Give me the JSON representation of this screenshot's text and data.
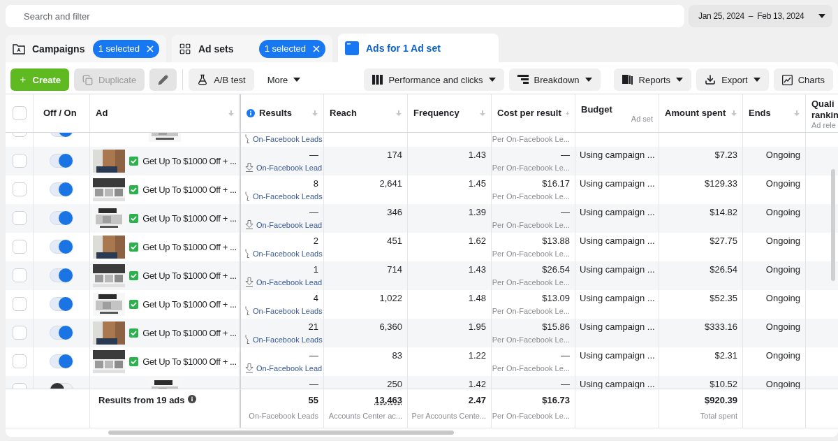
{
  "search": {
    "placeholder": "Search and filter"
  },
  "date_range": {
    "value": "Jan 25, 2024  –  Feb 13, 2024"
  },
  "tabs": [
    {
      "kind": "campaigns",
      "label": "Campaigns",
      "badge": "1 selected",
      "selected": false
    },
    {
      "kind": "adsets",
      "label": "Ad sets",
      "badge": "1 selected",
      "selected": false
    },
    {
      "kind": "ads",
      "label": "Ads for 1 Ad set",
      "selected": true
    }
  ],
  "toolbar": {
    "left": [
      {
        "kind": "create",
        "label": "Create",
        "disabled": false
      },
      {
        "kind": "duplicate",
        "label": "Duplicate",
        "disabled": true
      },
      {
        "kind": "edit",
        "disabled": true
      },
      {
        "kind": "abtest",
        "label": "A/B test",
        "disabled": false
      },
      {
        "kind": "more",
        "label": "More",
        "disabled": false
      }
    ],
    "right": [
      {
        "kind": "columns",
        "label": "Performance and clicks"
      },
      {
        "kind": "breakdown",
        "label": "Breakdown"
      },
      {
        "kind": "reports",
        "label": "Reports"
      },
      {
        "kind": "export",
        "label": "Export"
      },
      {
        "kind": "charts",
        "label": "Charts"
      }
    ]
  },
  "table": {
    "select_all": {
      "checked": false
    },
    "columns": [
      {
        "kind": "check"
      },
      {
        "label": "Off / On",
        "sortable": false
      },
      {
        "label": "Ad",
        "sortable": true
      },
      {
        "label": "Results",
        "sortable": true,
        "info": true
      },
      {
        "label": "Reach",
        "sortable": true
      },
      {
        "label": "Frequency",
        "sortable": true
      },
      {
        "label": "Cost per result",
        "sortable": true
      },
      {
        "label": "Budget",
        "sub": "Ad set",
        "sortable": false
      },
      {
        "label": "Amount spent",
        "sortable": true
      },
      {
        "label": "Ends",
        "sortable": true
      },
      {
        "label": "Quali rankin",
        "sub": "Ad rele"
      }
    ],
    "rows": [
      {
        "checked": false,
        "on": true,
        "results": {
          "kind": "hook",
          "unit": "On-Facebook Leads"
        },
        "cost": {
          "unit": "Per On-Facebook Le..."
        }
      },
      {
        "checked": false,
        "on": true,
        "ad": "Get Up To $1000 Off + ...",
        "results": {
          "kind": "arrow",
          "value": "—",
          "unit": "On-Facebook Lead"
        },
        "reach": "174",
        "frequency": "1.43",
        "cost": {
          "value": "—",
          "unit": "Per On-Facebook Le..."
        },
        "budget": "Using campaign ...",
        "amount": "$7.23",
        "ends": "Ongoing"
      },
      {
        "checked": false,
        "on": true,
        "ad": "Get Up To $1000 Off + ...",
        "results": {
          "kind": "hook",
          "value": "8",
          "unit": "On-Facebook Leads"
        },
        "reach": "2,641",
        "frequency": "1.45",
        "cost": {
          "value": "$16.17",
          "unit": "Per On-Facebook Le..."
        },
        "budget": "Using campaign ...",
        "amount": "$129.33",
        "ends": "Ongoing"
      },
      {
        "checked": false,
        "on": true,
        "ad": "Get Up To $1000 Off + ...",
        "results": {
          "kind": "arrow",
          "value": "—",
          "unit": "On-Facebook Lead"
        },
        "reach": "346",
        "frequency": "1.39",
        "cost": {
          "value": "—",
          "unit": "Per On-Facebook Le..."
        },
        "budget": "Using campaign ...",
        "amount": "$14.82",
        "ends": "Ongoing"
      },
      {
        "checked": false,
        "on": true,
        "ad": "Get Up To $1000 Off + ...",
        "results": {
          "kind": "hook",
          "value": "2",
          "unit": "On-Facebook Leads"
        },
        "reach": "451",
        "frequency": "1.62",
        "cost": {
          "value": "$13.88",
          "unit": "Per On-Facebook Le..."
        },
        "budget": "Using campaign ...",
        "amount": "$27.75",
        "ends": "Ongoing"
      },
      {
        "checked": false,
        "on": true,
        "ad": "Get Up To $1000 Off + ...",
        "results": {
          "kind": "arrow",
          "value": "1",
          "unit": "On-Facebook Lead"
        },
        "reach": "714",
        "frequency": "1.43",
        "cost": {
          "value": "$26.54",
          "unit": "Per On-Facebook Le..."
        },
        "budget": "Using campaign ...",
        "amount": "$26.54",
        "ends": "Ongoing"
      },
      {
        "checked": false,
        "on": true,
        "ad": "Get Up To $1000 Off + ...",
        "results": {
          "kind": "hook",
          "value": "4",
          "unit": "On-Facebook Leads"
        },
        "reach": "1,022",
        "frequency": "1.48",
        "cost": {
          "value": "$13.09",
          "unit": "Per On-Facebook Le..."
        },
        "budget": "Using campaign ...",
        "amount": "$52.35",
        "ends": "Ongoing"
      },
      {
        "checked": false,
        "on": true,
        "ad": "Get Up To $1000 Off + ...",
        "results": {
          "kind": "hook",
          "value": "21",
          "unit": "On-Facebook Leads"
        },
        "reach": "6,360",
        "frequency": "1.95",
        "cost": {
          "value": "$15.86",
          "unit": "Per On-Facebook Le..."
        },
        "budget": "Using campaign ...",
        "amount": "$333.16",
        "ends": "Ongoing"
      },
      {
        "checked": false,
        "on": true,
        "ad": "Get Up To $1000 Off + ...",
        "results": {
          "kind": "arrow",
          "value": "—",
          "unit": "On-Facebook Lead"
        },
        "reach": "83",
        "frequency": "1.22",
        "cost": {
          "value": "—",
          "unit": "Per On-Facebook Le..."
        },
        "budget": "Using campaign ...",
        "amount": "$2.31",
        "ends": "Ongoing"
      },
      {
        "checked": false,
        "on": false,
        "results": {
          "value": "—"
        },
        "reach": "250",
        "frequency": "1.42",
        "cost": {
          "value": "—"
        },
        "budget": "Using campaign ...",
        "amount": "$10.52",
        "ends": "Ongoing"
      }
    ],
    "footer": {
      "label": "Results from 19 ads",
      "results": {
        "value": "55",
        "unit": "On-Facebook Leads"
      },
      "reach": {
        "value": "13,463",
        "unit": "Accounts Center ac..."
      },
      "frequency": {
        "value": "2.47",
        "unit": "Per Accounts Cente..."
      },
      "cost": {
        "value": "$16.73",
        "unit": "Per On-Facebook Le..."
      },
      "amount": {
        "value": "$920.39",
        "unit": "Total spent"
      }
    }
  }
}
